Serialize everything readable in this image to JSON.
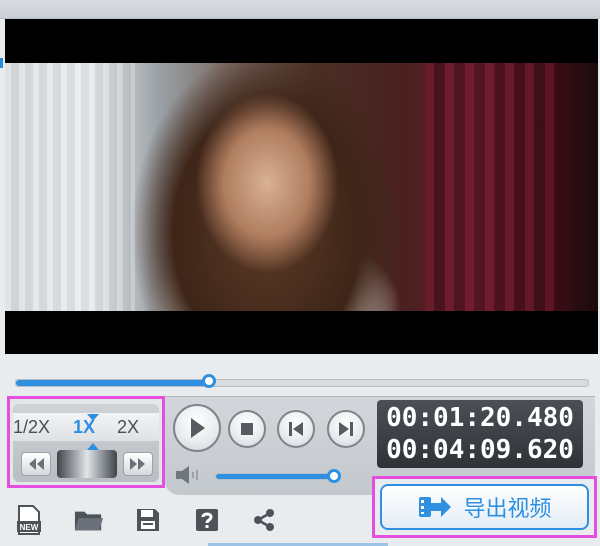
{
  "player": {
    "seek_progress": 0.34,
    "volume_level": 1.0,
    "current_time": "00:01:20.480",
    "total_time": "00:04:09.620"
  },
  "speed": {
    "options": [
      "1/2X",
      "1X",
      "2X"
    ],
    "selected": "1X"
  },
  "export": {
    "label": "导出视频"
  },
  "toolbar": {
    "icons": [
      "new-icon",
      "open-folder-icon",
      "save-icon",
      "help-icon",
      "share-icon"
    ],
    "new_badge": "NEW"
  },
  "colors": {
    "accent": "#2f8fe0",
    "highlight_border": "#e44fe0",
    "time_bg": "#3a3f44"
  }
}
